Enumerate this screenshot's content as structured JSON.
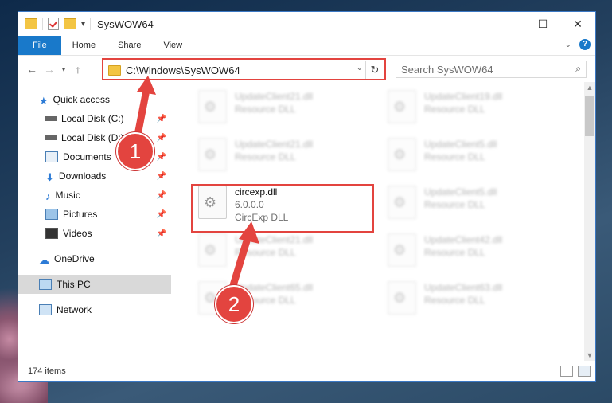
{
  "window": {
    "title": "SysWOW64",
    "controls": {
      "minimize": "—",
      "maximize": "☐",
      "close": "✕"
    }
  },
  "ribbon": {
    "tabs": [
      "File",
      "Home",
      "Share",
      "View"
    ]
  },
  "nav": {
    "address": "C:\\Windows\\SysWOW64",
    "search_placeholder": "Search SysWOW64"
  },
  "sidebar": {
    "items": [
      {
        "label": "Quick access",
        "icon": "star-icon"
      },
      {
        "label": "Local Disk (C:)",
        "icon": "drive-icon",
        "pinned": true
      },
      {
        "label": "Local Disk (D:)",
        "icon": "drive-icon",
        "pinned": true
      },
      {
        "label": "Documents",
        "icon": "documents-icon",
        "pinned": true
      },
      {
        "label": "Downloads",
        "icon": "download-icon",
        "pinned": true
      },
      {
        "label": "Music",
        "icon": "music-icon",
        "pinned": true
      },
      {
        "label": "Pictures",
        "icon": "pictures-icon",
        "pinned": true
      },
      {
        "label": "Videos",
        "icon": "videos-icon",
        "pinned": true
      },
      {
        "label": "OneDrive",
        "icon": "cloud-icon"
      },
      {
        "label": "This PC",
        "icon": "pc-icon",
        "selected": true
      },
      {
        "label": "Network",
        "icon": "network-icon"
      }
    ]
  },
  "files": [
    {
      "name": "UpdateClient21.dll",
      "line2": "Resource DLL"
    },
    {
      "name": "UpdateClient19.dll",
      "line2": "Resource DLL"
    },
    {
      "name": "UpdateClient21.dll",
      "line2": "Resource DLL"
    },
    {
      "name": "UpdateClient5.dll",
      "line2": "Resource DLL"
    },
    {
      "name": "circexp.dll",
      "line2": "6.0.0.0",
      "line3": "CircExp DLL"
    },
    {
      "name": "UpdateClient5.dll",
      "line2": "Resource DLL"
    },
    {
      "name": "UpdateClient21.dll",
      "line2": "Resource DLL"
    },
    {
      "name": "UpdateClient42.dll",
      "line2": "Resource DLL"
    },
    {
      "name": "UpdateClient65.dll",
      "line2": "Resource DLL"
    },
    {
      "name": "UpdateClient63.dll",
      "line2": "Resource DLL"
    }
  ],
  "status": {
    "items": "174 items"
  },
  "callouts": [
    "1",
    "2"
  ],
  "colors": {
    "accent": "#1979ca",
    "highlight": "#e3443f"
  }
}
